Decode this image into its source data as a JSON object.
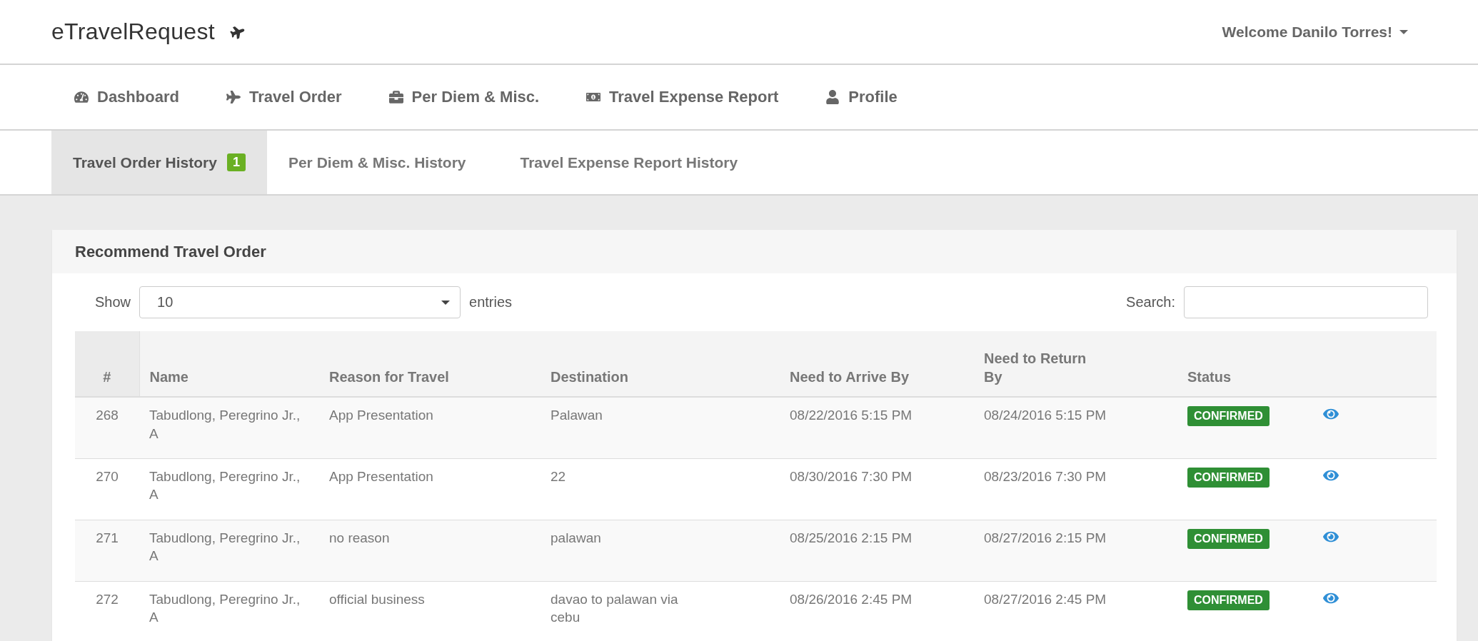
{
  "header": {
    "title": "eTravelRequest",
    "user_menu": "Welcome Danilo Torres!"
  },
  "nav": [
    {
      "label": "Dashboard"
    },
    {
      "label": "Travel Order"
    },
    {
      "label": "Per Diem & Misc."
    },
    {
      "label": "Travel Expense Report"
    },
    {
      "label": "Profile"
    }
  ],
  "subtabs": [
    {
      "label": "Travel Order History",
      "selected": true,
      "badge": "1"
    },
    {
      "label": "Per Diem & Misc. History",
      "selected": false
    },
    {
      "label": "Travel Expense Report History",
      "selected": false
    }
  ],
  "panel": {
    "title": "Recommend Travel Order",
    "show_label": "Show",
    "page_size": "10",
    "entries_label": "entries",
    "search_label": "Search:"
  },
  "table": {
    "columns": [
      "#",
      "Name",
      "Reason for Travel",
      "Destination",
      "Need to Arrive By",
      "Need to Return By",
      "Status"
    ],
    "rows": [
      {
        "id": "268",
        "name": "Tabudlong, Peregrino Jr., A",
        "reason": "App Presentation",
        "destination": "Palawan",
        "arrive": "08/22/2016 5:15 PM",
        "return": "08/24/2016 5:15 PM",
        "status": "CONFIRMED"
      },
      {
        "id": "270",
        "name": "Tabudlong, Peregrino Jr., A",
        "reason": "App Presentation",
        "destination": "22",
        "arrive": "08/30/2016 7:30 PM",
        "return": "08/23/2016 7:30 PM",
        "status": "CONFIRMED"
      },
      {
        "id": "271",
        "name": "Tabudlong, Peregrino Jr., A",
        "reason": "no reason",
        "destination": "palawan",
        "arrive": "08/25/2016 2:15 PM",
        "return": "08/27/2016 2:15 PM",
        "status": "CONFIRMED"
      },
      {
        "id": "272",
        "name": "Tabudlong, Peregrino Jr., A",
        "reason": "official business",
        "destination": "davao to palawan via cebu",
        "arrive": "08/26/2016 2:45 PM",
        "return": "08/27/2016 2:45 PM",
        "status": "CONFIRMED"
      }
    ]
  }
}
